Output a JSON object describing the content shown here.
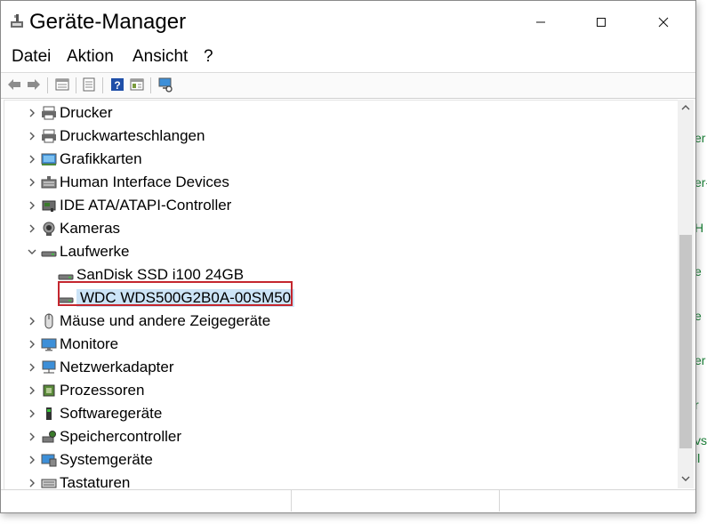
{
  "window": {
    "title": "Geräte-Manager",
    "controls": {
      "minimize": "—",
      "maximize": "☐",
      "close": "✕"
    }
  },
  "menu": [
    "Datei",
    "Aktion",
    "Ansicht",
    "?"
  ],
  "toolbar": [
    "back-icon",
    "forward-icon",
    "properties-icon",
    "update-icon",
    "help-icon",
    "view-icon",
    "scan-hardware-icon"
  ],
  "tree": [
    {
      "label": "Drucker",
      "icon": "printer-icon",
      "level": 0,
      "expanded": false
    },
    {
      "label": "Druckwarteschlangen",
      "icon": "print-queue-icon",
      "level": 0,
      "expanded": false
    },
    {
      "label": "Grafikkarten",
      "icon": "display-adapter-icon",
      "level": 0,
      "expanded": false
    },
    {
      "label": "Human Interface Devices",
      "icon": "hid-icon",
      "level": 0,
      "expanded": false
    },
    {
      "label": "IDE ATA/ATAPI-Controller",
      "icon": "ide-controller-icon",
      "level": 0,
      "expanded": false
    },
    {
      "label": "Kameras",
      "icon": "camera-icon",
      "level": 0,
      "expanded": false
    },
    {
      "label": "Laufwerke",
      "icon": "disk-drive-icon",
      "level": 0,
      "expanded": true
    },
    {
      "label": "SanDisk SSD i100 24GB",
      "icon": "disk-drive-icon",
      "level": 1
    },
    {
      "label": "WDC  WDS500G2B0A-00SM50",
      "icon": "disk-drive-icon",
      "level": 1,
      "selected": true
    },
    {
      "label": "Mäuse und andere Zeigegeräte",
      "icon": "mouse-icon",
      "level": 0,
      "expanded": false
    },
    {
      "label": "Monitore",
      "icon": "monitor-icon",
      "level": 0,
      "expanded": false
    },
    {
      "label": "Netzwerkadapter",
      "icon": "network-adapter-icon",
      "level": 0,
      "expanded": false
    },
    {
      "label": "Prozessoren",
      "icon": "processor-icon",
      "level": 0,
      "expanded": false
    },
    {
      "label": "Softwaregeräte",
      "icon": "software-device-icon",
      "level": 0,
      "expanded": false
    },
    {
      "label": "Speichercontroller",
      "icon": "storage-controller-icon",
      "level": 0,
      "expanded": false
    },
    {
      "label": "Systemgeräte",
      "icon": "system-device-icon",
      "level": 0,
      "expanded": false
    },
    {
      "label": "Tastaturen",
      "icon": "keyboard-icon",
      "level": 0,
      "expanded": false
    }
  ],
  "background_peek": [
    "er",
    "er-",
    "H",
    "e",
    "e",
    "er",
    "r",
    "vs",
    "ll"
  ],
  "colors": {
    "selection": "#cce4f7",
    "highlight_box": "#c4262e",
    "bg_text": "#1a7f37"
  }
}
